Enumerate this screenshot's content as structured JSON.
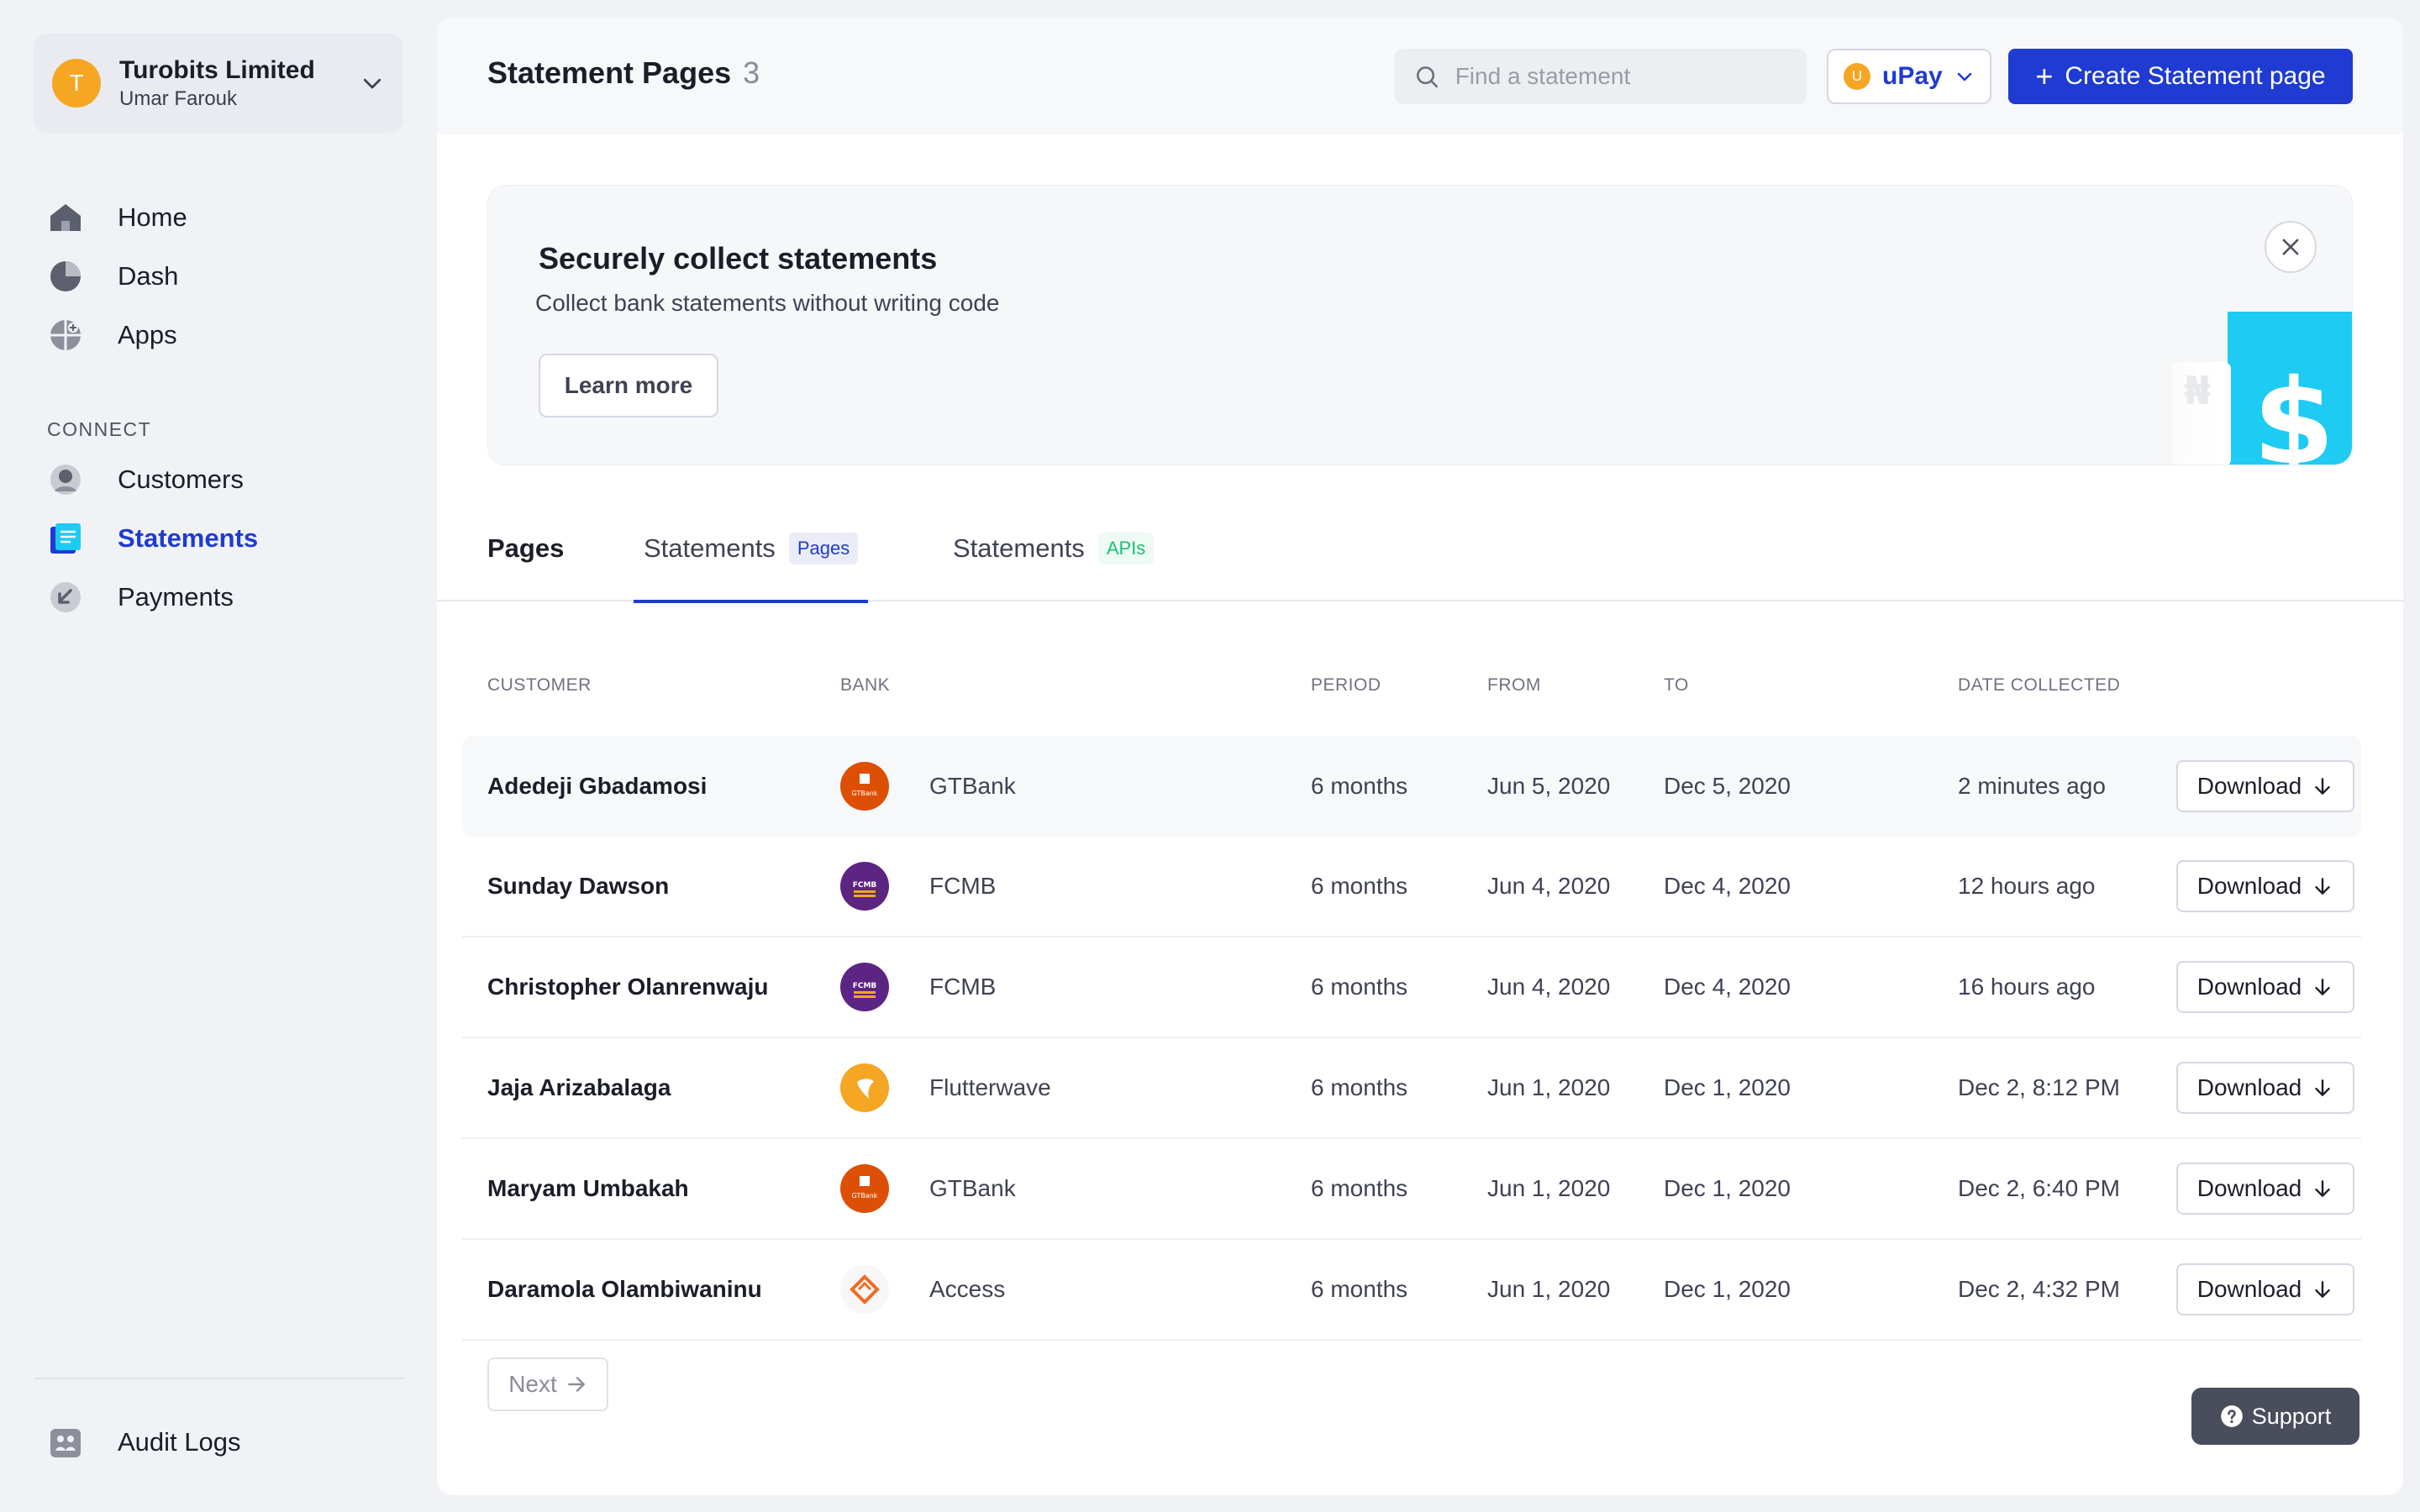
{
  "org": {
    "initial": "T",
    "name": "Turobits Limited",
    "user": "Umar Farouk"
  },
  "nav": {
    "main": [
      {
        "label": "Home",
        "icon": "home-icon"
      },
      {
        "label": "Dash",
        "icon": "pie-chart-icon"
      },
      {
        "label": "Apps",
        "icon": "apps-icon"
      }
    ],
    "section_label": "CONNECT",
    "connect": [
      {
        "label": "Customers",
        "icon": "user-icon"
      },
      {
        "label": "Statements",
        "icon": "document-icon",
        "active": true
      },
      {
        "label": "Payments",
        "icon": "payment-icon"
      }
    ],
    "footer": {
      "label": "Audit Logs",
      "icon": "audit-icon"
    }
  },
  "header": {
    "title": "Statement Pages",
    "count": "3",
    "search_placeholder": "Find a statement",
    "app_initial": "U",
    "app_name": "uPay",
    "create_label": "Create Statement page"
  },
  "banner": {
    "title": "Securely collect statements",
    "subtitle": "Collect bank statements without writing code",
    "learn_more": "Learn more"
  },
  "tabs": [
    {
      "label": "Pages",
      "badge": ""
    },
    {
      "label": "Statements",
      "badge": "Pages"
    },
    {
      "label": "Statements",
      "badge": "APIs"
    }
  ],
  "table": {
    "headers": {
      "customer": "CUSTOMER",
      "bank": "BANK",
      "period": "PERIOD",
      "from": "FROM",
      "to": "TO",
      "date_collected": "DATE COLLECTED"
    },
    "download_label": "Download",
    "rows": [
      {
        "customer": "Adedeji Gbadamosi",
        "bank": "GTBank",
        "period": "6 months",
        "from": "Jun 5, 2020",
        "to": "Dec 5, 2020",
        "date": "2 minutes ago"
      },
      {
        "customer": "Sunday Dawson",
        "bank": "FCMB",
        "period": "6 months",
        "from": "Jun 4, 2020",
        "to": "Dec 4, 2020",
        "date": "12 hours ago"
      },
      {
        "customer": "Christopher Olanrenwaju",
        "bank": "FCMB",
        "period": "6 months",
        "from": "Jun 4, 2020",
        "to": "Dec 4, 2020",
        "date": "16 hours ago"
      },
      {
        "customer": "Jaja Arizabalaga",
        "bank": "Flutterwave",
        "period": "6 months",
        "from": "Jun 1, 2020",
        "to": "Dec 1, 2020",
        "date": "Dec 2, 8:12 PM"
      },
      {
        "customer": "Maryam Umbakah",
        "bank": "GTBank",
        "period": "6 months",
        "from": "Jun 1, 2020",
        "to": "Dec 1, 2020",
        "date": "Dec 2, 6:40 PM"
      },
      {
        "customer": "Daramola Olambiwaninu",
        "bank": "Access",
        "period": "6 months",
        "from": "Jun 1, 2020",
        "to": "Dec 1, 2020",
        "date": "Dec 2, 4:32 PM"
      }
    ]
  },
  "bank_logo_text": {
    "gtbank": "GTBank",
    "fcmb": "FCMB"
  },
  "pagination": {
    "next_label": "Next"
  },
  "support": {
    "label": "Support"
  },
  "colors": {
    "accent": "#1f3bd1",
    "gtbank": "#dd4f05",
    "fcmb": "#5c2483",
    "flutterwave": "#f5a623",
    "access": "#f26b22",
    "banner_art": "#1ecbf2"
  }
}
